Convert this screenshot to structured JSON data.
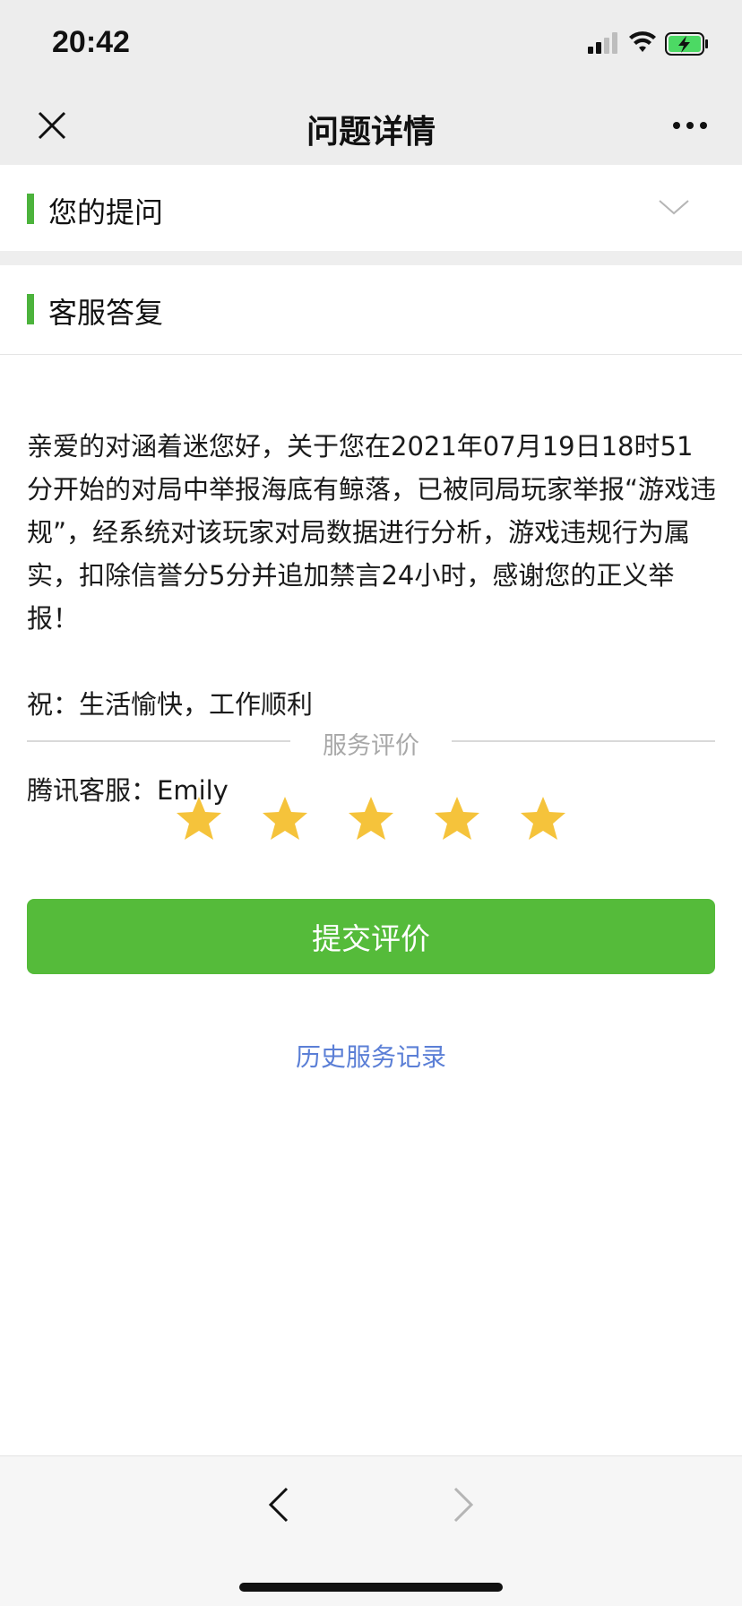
{
  "status_bar": {
    "time": "20:42",
    "icons": [
      "signal-icon",
      "wifi-icon",
      "battery-charging-icon"
    ]
  },
  "nav": {
    "title": "问题详情",
    "left_icon": "close-icon",
    "right_icon": "more-icon"
  },
  "question_section": {
    "label": "您的提问",
    "toggle_icon": "chevron-down-icon"
  },
  "reply_section": {
    "label": "客服答复",
    "body": "亲爱的对涵着迷您好，关于您在2021年07月19日18时51分开始的对局中举报海底有鲸落，已被同局玩家举报“游戏违规”，经系统对该玩家对局数据进行分析，游戏违规行为属实，扣除信誉分5分并追加禁言24小时，感谢您的正义举报！",
    "blessing": "祝：生活愉快，工作顺利",
    "signature": "腾讯客服：Emily"
  },
  "rating": {
    "title": "服务评价",
    "stars_total": 5,
    "stars_selected": 5,
    "star_color": "#f5c33b"
  },
  "submit": {
    "label": "提交评价",
    "color": "#55bb3a"
  },
  "history": {
    "label": "历史服务记录",
    "color": "#5b7fd6"
  },
  "bottom_nav": {
    "back_icon": "chevron-left-icon",
    "forward_icon": "chevron-right-icon"
  },
  "accent_color": "#4cb33c"
}
